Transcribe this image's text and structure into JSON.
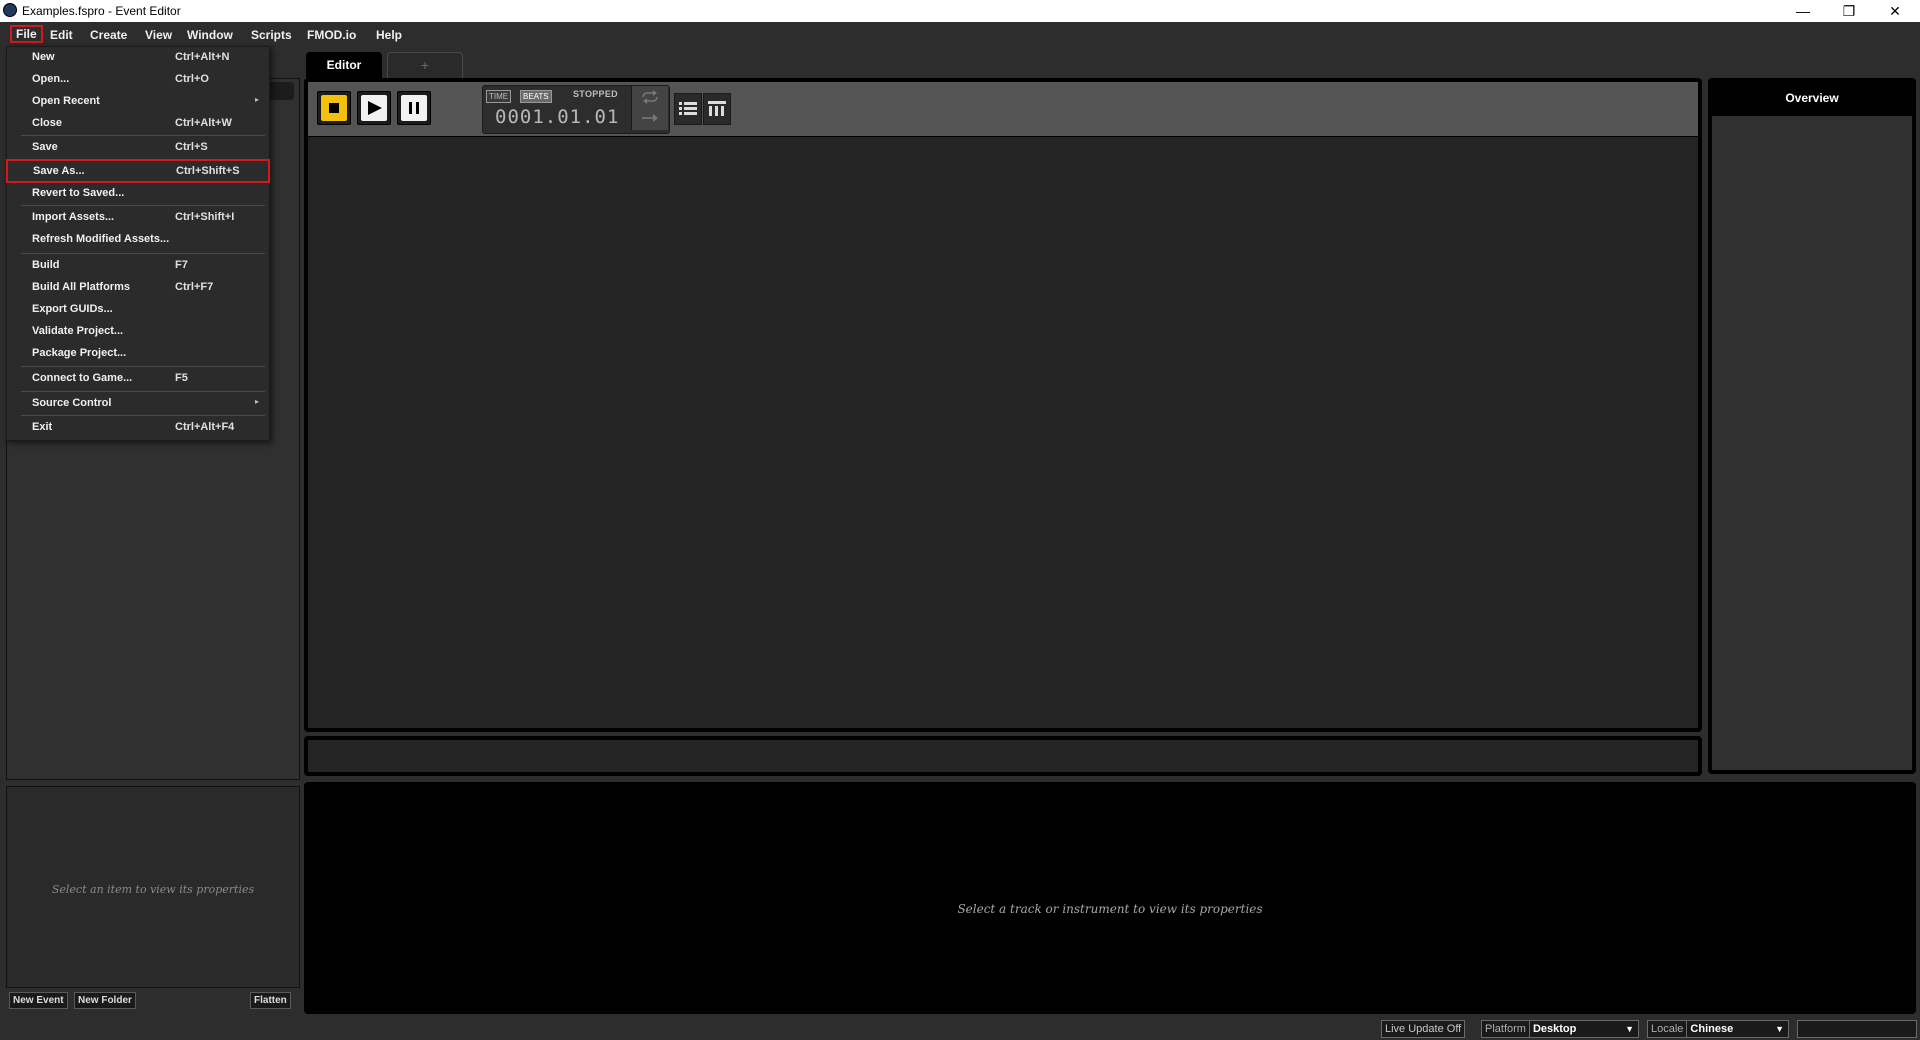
{
  "window": {
    "title": "Examples.fspro - Event Editor",
    "minimize": "—",
    "restore": "❐",
    "close": "✕"
  },
  "menubar": [
    "File",
    "Edit",
    "Create",
    "View",
    "Window",
    "Scripts",
    "FMOD.io",
    "Help"
  ],
  "file_menu": {
    "new": {
      "label": "New",
      "shortcut": "Ctrl+Alt+N"
    },
    "open": {
      "label": "Open...",
      "shortcut": "Ctrl+O"
    },
    "open_recent": {
      "label": "Open Recent",
      "submenu": "▸"
    },
    "close": {
      "label": "Close",
      "shortcut": "Ctrl+Alt+W"
    },
    "save": {
      "label": "Save",
      "shortcut": "Ctrl+S"
    },
    "save_as": {
      "label": "Save As...",
      "shortcut": "Ctrl+Shift+S"
    },
    "revert": {
      "label": "Revert to Saved..."
    },
    "import_assets": {
      "label": "Import Assets...",
      "shortcut": "Ctrl+Shift+I"
    },
    "refresh_assets": {
      "label": "Refresh Modified Assets..."
    },
    "build": {
      "label": "Build",
      "shortcut": "F7"
    },
    "build_all": {
      "label": "Build All Platforms",
      "shortcut": "Ctrl+F7"
    },
    "export_guids": {
      "label": "Export GUIDs..."
    },
    "validate": {
      "label": "Validate Project..."
    },
    "package": {
      "label": "Package Project..."
    },
    "connect": {
      "label": "Connect to Game...",
      "shortcut": "F5"
    },
    "source_control": {
      "label": "Source Control",
      "submenu": "▸"
    },
    "exit": {
      "label": "Exit",
      "shortcut": "Ctrl+Alt+F4"
    }
  },
  "editor": {
    "tab_label": "Editor",
    "add_tab": "+",
    "time_tag": "TIME",
    "beats_tag": "BEATS",
    "status": "STOPPED",
    "position": "0001.01.01"
  },
  "overview": {
    "title": "Overview"
  },
  "left_panel": {
    "props_message": "Select an item to view its properties",
    "new_event": "New Event",
    "new_folder": "New Folder",
    "flatten": "Flatten"
  },
  "bottom": {
    "message": "Select a track or instrument to view its properties"
  },
  "statusbar": {
    "live_update": "Live Update Off",
    "platform_label": "Platform",
    "platform_value": "Desktop",
    "locale_label": "Locale",
    "locale_value": "Chinese",
    "dropdown_arrow": "▼"
  },
  "colors": {
    "accent_stop": "#f3c10c",
    "highlight": "#d11a1a"
  }
}
